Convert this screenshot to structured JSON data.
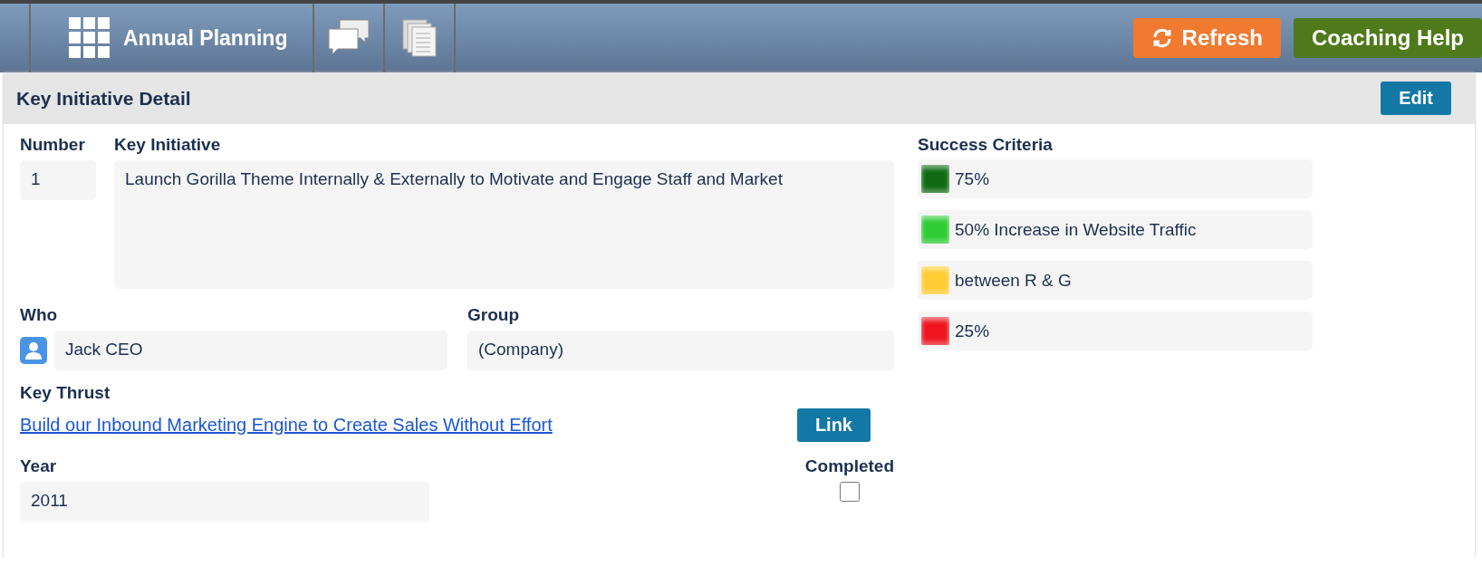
{
  "toolbar": {
    "app_title": "Annual Planning",
    "refresh_button": "Refresh",
    "help_button": "Coaching Help"
  },
  "panel": {
    "title": "Key Initiative Detail",
    "edit_button": "Edit"
  },
  "fields": {
    "number_label": "Number",
    "number": "1",
    "initiative_label": "Key Initiative",
    "initiative": "Launch Gorilla Theme Internally & Externally to Motivate and Engage Staff and Market",
    "who_label": "Who",
    "who": "Jack CEO",
    "group_label": "Group",
    "group": "(Company)",
    "thrust_label": "Key Thrust",
    "thrust": "Build our Inbound Marketing Engine to Create Sales Without Effort",
    "link_button": "Link",
    "year_label": "Year",
    "year": "2011",
    "completed_label": "Completed",
    "completed": false
  },
  "success_criteria": {
    "label": "Success Criteria",
    "items": [
      {
        "text": "75%",
        "color": "#0f6a12"
      },
      {
        "text": "50% Increase in Website Traffic",
        "color": "#2fcc35"
      },
      {
        "text": "between R & G",
        "color": "#ffcc33"
      },
      {
        "text": "25%",
        "color": "#ee1520"
      }
    ]
  }
}
